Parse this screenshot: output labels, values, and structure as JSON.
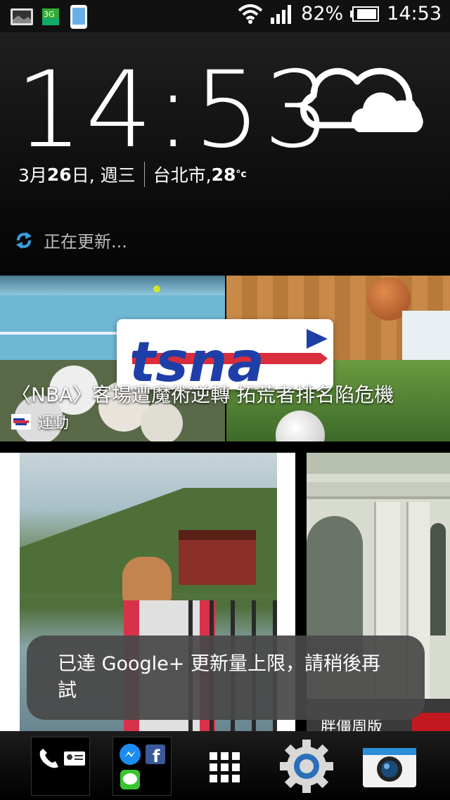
{
  "status_bar": {
    "battery_percent": "82%",
    "time": "14:53",
    "network_type": "3G",
    "icons": [
      "gallery-notification-icon",
      "3g-data-icon",
      "phone-storage-icon",
      "wifi-icon",
      "signal-icon",
      "battery-icon"
    ]
  },
  "clock_widget": {
    "time": "14:53",
    "date_prefix": "3月 ",
    "date_day": "26",
    "date_suffix": " 日, 週三",
    "city": "台北市, ",
    "temperature": "28",
    "temperature_unit": "°c",
    "weather_icon": "cloudy-icon"
  },
  "updating": {
    "text": "正在更新..."
  },
  "news_card": {
    "logo_text": "tsna",
    "title": "〈NBA〉客場遭魔術逆轉  拓荒者排名陷危機",
    "source": "運動"
  },
  "photos": {
    "sign_text": "胖僵周版"
  },
  "toast": {
    "message": "已達 Google+ 更新量上限，請稍後再試"
  },
  "dock": {
    "items": [
      "phone-contacts-folder",
      "messenger-facebook-line-folder",
      "all-apps-button",
      "settings-button",
      "camera-button"
    ]
  },
  "colors": {
    "accent": "#3aa0e0",
    "toast_bg": "#484848",
    "background": "#000000"
  }
}
